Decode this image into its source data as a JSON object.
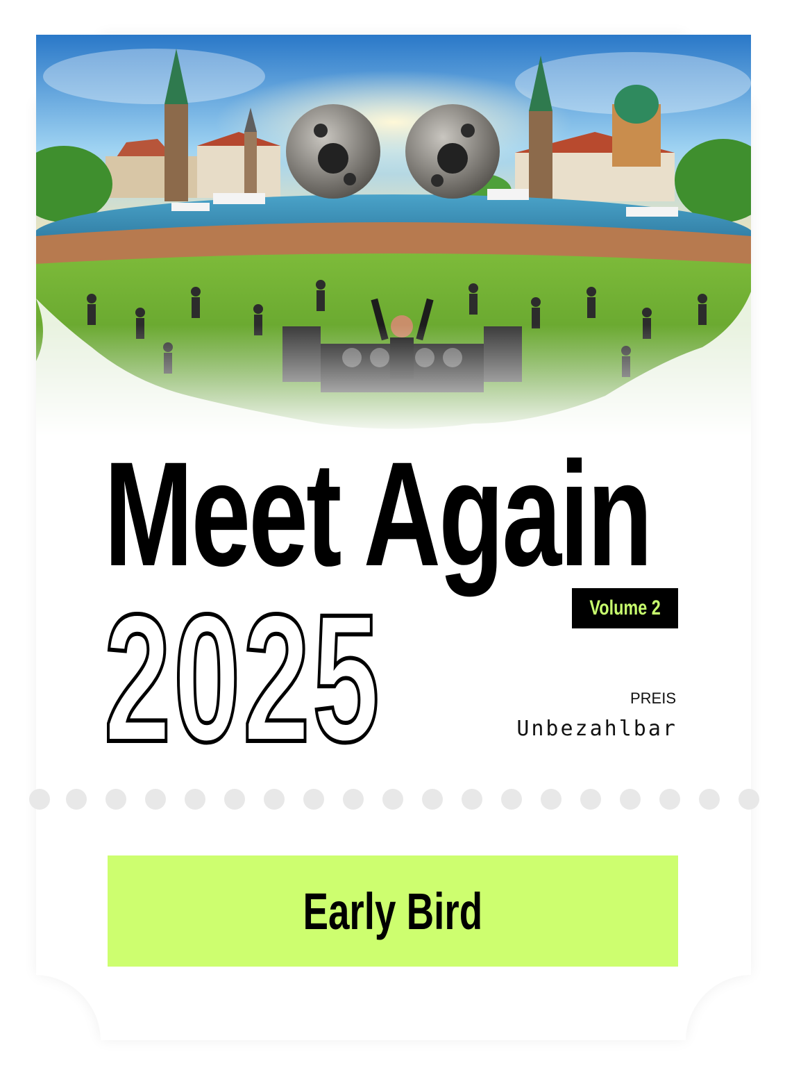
{
  "ticket": {
    "title": "Meet Again",
    "year": "2025",
    "volume": "Volume 2",
    "price_label": "PREIS",
    "price_value": "Unbezahlbar",
    "ticket_type": "Early Bird"
  },
  "hero": {
    "description_icon": "festival-illustration"
  },
  "colors": {
    "accent": "#cdfe6f",
    "volume_text": "#c8ff6e",
    "background": "#ffffff",
    "perforation": "#e8e8e8"
  }
}
